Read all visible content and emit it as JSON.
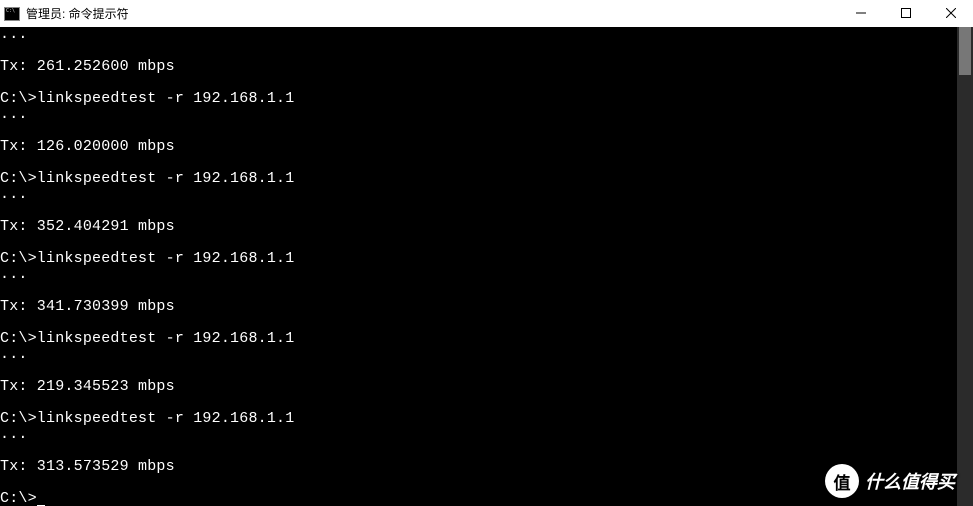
{
  "window": {
    "title": "管理员: 命令提示符"
  },
  "terminal": {
    "lines": [
      "...",
      "",
      "Tx: 261.252600 mbps",
      "",
      "C:\\>linkspeedtest -r 192.168.1.1",
      "...",
      "",
      "Tx: 126.020000 mbps",
      "",
      "C:\\>linkspeedtest -r 192.168.1.1",
      "...",
      "",
      "Tx: 352.404291 mbps",
      "",
      "C:\\>linkspeedtest -r 192.168.1.1",
      "...",
      "",
      "Tx: 341.730399 mbps",
      "",
      "C:\\>linkspeedtest -r 192.168.1.1",
      "...",
      "",
      "Tx: 219.345523 mbps",
      "",
      "C:\\>linkspeedtest -r 192.168.1.1",
      "...",
      "",
      "Tx: 313.573529 mbps",
      "",
      "C:\\>"
    ]
  },
  "watermark": {
    "badge": "值",
    "text": "什么值得买"
  }
}
